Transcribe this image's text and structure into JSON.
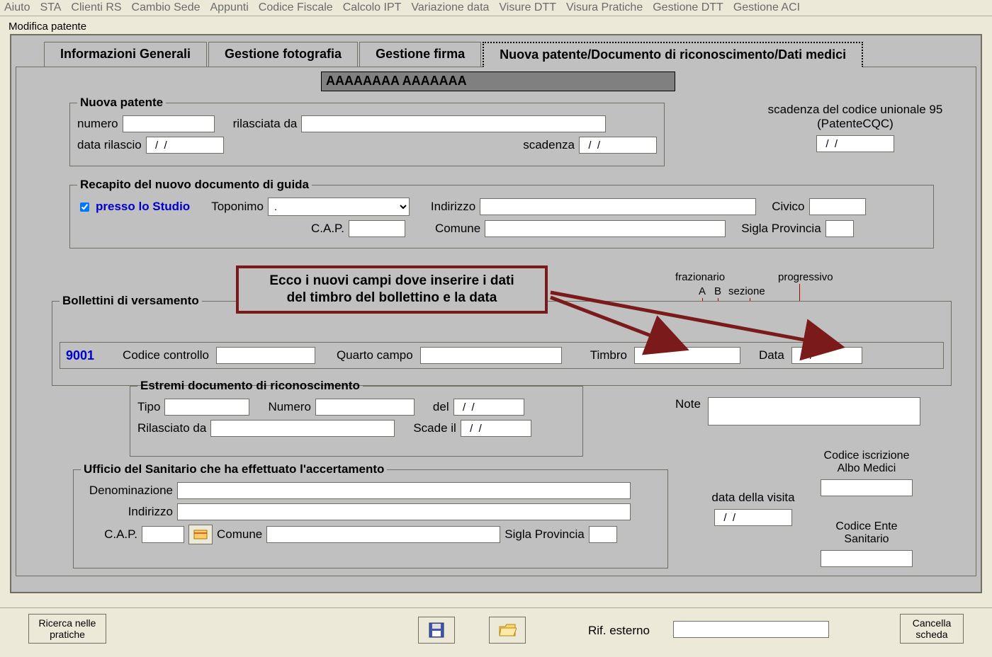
{
  "menu": [
    "Aiuto",
    "STA",
    "Clienti RS",
    "Cambio Sede",
    "Appunti",
    "Codice Fiscale",
    "Calcolo IPT",
    "Variazione data",
    "Visure DTT",
    "Visura Pratiche",
    "Gestione DTT",
    "Gestione ACI"
  ],
  "window_title": "Modifica patente",
  "tabs": {
    "t0": "Informazioni Generali",
    "t1": "Gestione fotografia",
    "t2": "Gestione firma",
    "t3": "Nuova patente/Documento di riconoscimento/Dati medici"
  },
  "banner": "AAAAAAAA AAAAAAA",
  "nuova": {
    "legend": "Nuova patente",
    "numero_lbl": "numero",
    "rilasciata_lbl": "rilasciata da",
    "data_rilascio_lbl": "data rilascio",
    "data_rilascio_val": "  /  /",
    "scadenza_lbl": "scadenza",
    "scadenza_val": "  /  /"
  },
  "cqc": {
    "line1": "scadenza del codice unionale 95",
    "line2": "(PatenteCQC)",
    "val": "  /  /"
  },
  "recapito": {
    "legend": "Recapito del nuovo documento di guida",
    "presso": "presso lo Studio",
    "toponimo_lbl": "Toponimo",
    "indirizzo_lbl": "Indirizzo",
    "civico_lbl": "Civico",
    "cap_lbl": "C.A.P.",
    "comune_lbl": "Comune",
    "sigla_lbl": "Sigla Provincia"
  },
  "callout": {
    "l1": "Ecco i nuovi campi dove inserire i dati",
    "l2": "del timbro del bollettino e la data"
  },
  "annot": {
    "fraz": "frazionario",
    "a": "A",
    "b": "B",
    "sez": "sezione",
    "prog": "progressivo"
  },
  "boll": {
    "legend": "Bollettini di versamento",
    "code": "9001",
    "cc_lbl": "Codice controllo",
    "qc_lbl": "Quarto campo",
    "timbro_lbl": "Timbro",
    "data_lbl": "Data",
    "data_val": "  /  /"
  },
  "estremi": {
    "legend": "Estremi documento di riconoscimento",
    "tipo_lbl": "Tipo",
    "numero_lbl": "Numero",
    "del_lbl": "del",
    "del_val": "  /  /",
    "ril_lbl": "Rilasciato da",
    "scade_lbl": "Scade il",
    "scade_val": "  /  /"
  },
  "note_lbl": "Note",
  "right": {
    "albo1": "Codice iscrizione",
    "albo2": "Albo Medici",
    "visita_lbl": "data della visita",
    "visita_val": "  /  /",
    "ente1": "Codice Ente",
    "ente2": "Sanitario"
  },
  "uff": {
    "legend": "Ufficio del Sanitario che ha effettuato l'accertamento",
    "den_lbl": "Denominazione",
    "ind_lbl": "Indirizzo",
    "cap_lbl": "C.A.P.",
    "com_lbl": "Comune",
    "sigla_lbl": "Sigla Provincia"
  },
  "bottom": {
    "ricerca1": "Ricerca nelle",
    "ricerca2": "pratiche",
    "rif_lbl": "Rif. esterno",
    "cancella1": "Cancella",
    "cancella2": "scheda"
  }
}
